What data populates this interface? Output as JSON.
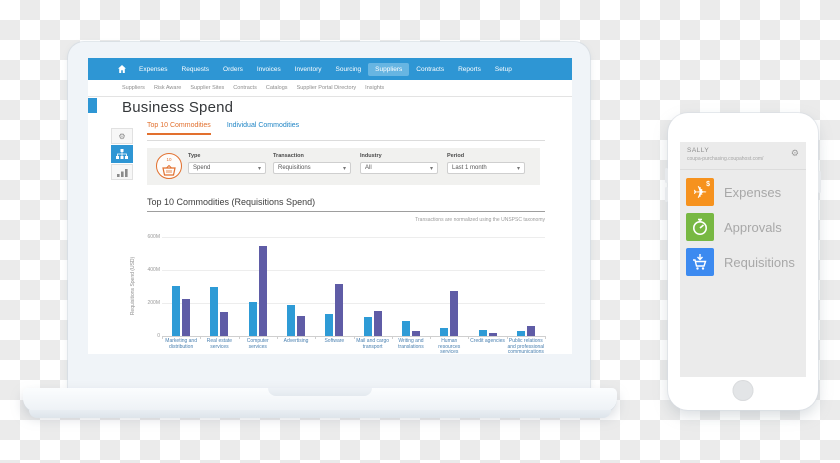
{
  "laptop": {
    "page_title": "Business Spend",
    "topnav": {
      "items": [
        "Expenses",
        "Requests",
        "Orders",
        "Invoices",
        "Inventory",
        "Sourcing",
        "Suppliers",
        "Contracts",
        "Reports",
        "Setup"
      ],
      "active": "Suppliers"
    },
    "subnav": {
      "items": [
        "Suppliers",
        "Risk Aware",
        "Supplier Sites",
        "Contracts",
        "Catalogs",
        "Supplier Portal Directory",
        "Insights"
      ]
    },
    "tabs": [
      {
        "label": "Top 10 Commodities",
        "active": true
      },
      {
        "label": "Individual Commodities",
        "active": false
      }
    ],
    "filter_badge": "10",
    "filters": [
      {
        "label": "Type",
        "value": "Spend"
      },
      {
        "label": "Transaction",
        "value": "Requisitions"
      },
      {
        "label": "Industry",
        "value": "All"
      },
      {
        "label": "Period",
        "value": "Last 1 month"
      }
    ],
    "chart_title": "Top 10 Commodities (Requisitions Spend)",
    "chart_note": "Transactions are normalized using the UNSPSC taxonomy"
  },
  "chart_data": {
    "type": "bar",
    "title": "Top 10 Commodities (Requisitions Spend)",
    "ylabel": "Requisitions Spend (USD)",
    "unit": "millions USD",
    "ylim": [
      0,
      600
    ],
    "yticks": [
      {
        "value": 0,
        "label": "0"
      },
      {
        "value": 200,
        "label": "200M"
      },
      {
        "value": 400,
        "label": "400M"
      },
      {
        "value": 600,
        "label": "600M"
      }
    ],
    "grid": true,
    "legend": "none",
    "categories": [
      "Marketing and distribution",
      "Real estate services",
      "Computer services",
      "Advertising",
      "Software",
      "Mail and cargo transport",
      "Writing and translations",
      "Human resources services",
      "Credit agencies",
      "Public relations and professional communications"
    ],
    "series": [
      {
        "name": "series-blue",
        "color": "#2e9bd6",
        "values": [
          305,
          295,
          205,
          185,
          133,
          115,
          92,
          48,
          36,
          30
        ]
      },
      {
        "name": "series-purple",
        "color": "#5f5ca6",
        "values": [
          222,
          148,
          548,
          122,
          318,
          152,
          30,
          272,
          16,
          58
        ]
      }
    ]
  },
  "phone": {
    "user": "SALLY",
    "url": "coupa-purchasing.coupahost.com/",
    "gear_icon": "gear-icon",
    "menu": [
      {
        "label": "Expenses",
        "color": "#f6921e",
        "icon": "airplane-expense-icon"
      },
      {
        "label": "Approvals",
        "color": "#78b843",
        "icon": "stopwatch-icon"
      },
      {
        "label": "Requisitions",
        "color": "#3c8af0",
        "icon": "cart-icon"
      }
    ]
  }
}
